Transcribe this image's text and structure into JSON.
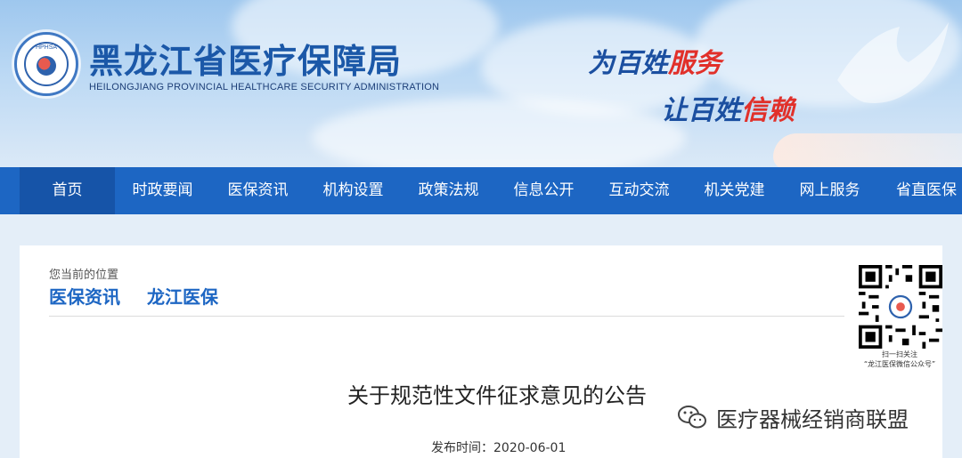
{
  "header": {
    "logo_abbr": "HPHSA",
    "site_title": "黑龙江省医疗保障局",
    "site_subtitle": "HEILONGJIANG PROVINCIAL HEALTHCARE SECURITY ADMINISTRATION",
    "slogan1_prefix": "为百姓",
    "slogan1_highlight": "服务",
    "slogan2_prefix": "让百姓",
    "slogan2_highlight": "信赖"
  },
  "nav": {
    "items": [
      {
        "label": "首页",
        "active": true
      },
      {
        "label": "时政要闻"
      },
      {
        "label": "医保资讯"
      },
      {
        "label": "机构设置"
      },
      {
        "label": "政策法规"
      },
      {
        "label": "信息公开"
      },
      {
        "label": "互动交流"
      },
      {
        "label": "机关党建"
      },
      {
        "label": "网上服务"
      },
      {
        "label": "省直医保"
      }
    ]
  },
  "location": {
    "label": "您当前的位置",
    "crumbs": [
      "医保资讯",
      "龙江医保"
    ]
  },
  "qr": {
    "caption1": "扫一扫关注",
    "caption2": "“龙江医保微信公众号”"
  },
  "article": {
    "title": "关于规范性文件征求意见的公告",
    "pub_label": "发布时间：",
    "pub_date": "2020-06-01"
  },
  "watermark": {
    "text": "医疗器械经销商联盟"
  },
  "colors": {
    "nav_bg": "#1d66c3",
    "nav_active": "#1654a8",
    "title_blue": "#1b58a8",
    "accent_red": "#e1302a"
  }
}
